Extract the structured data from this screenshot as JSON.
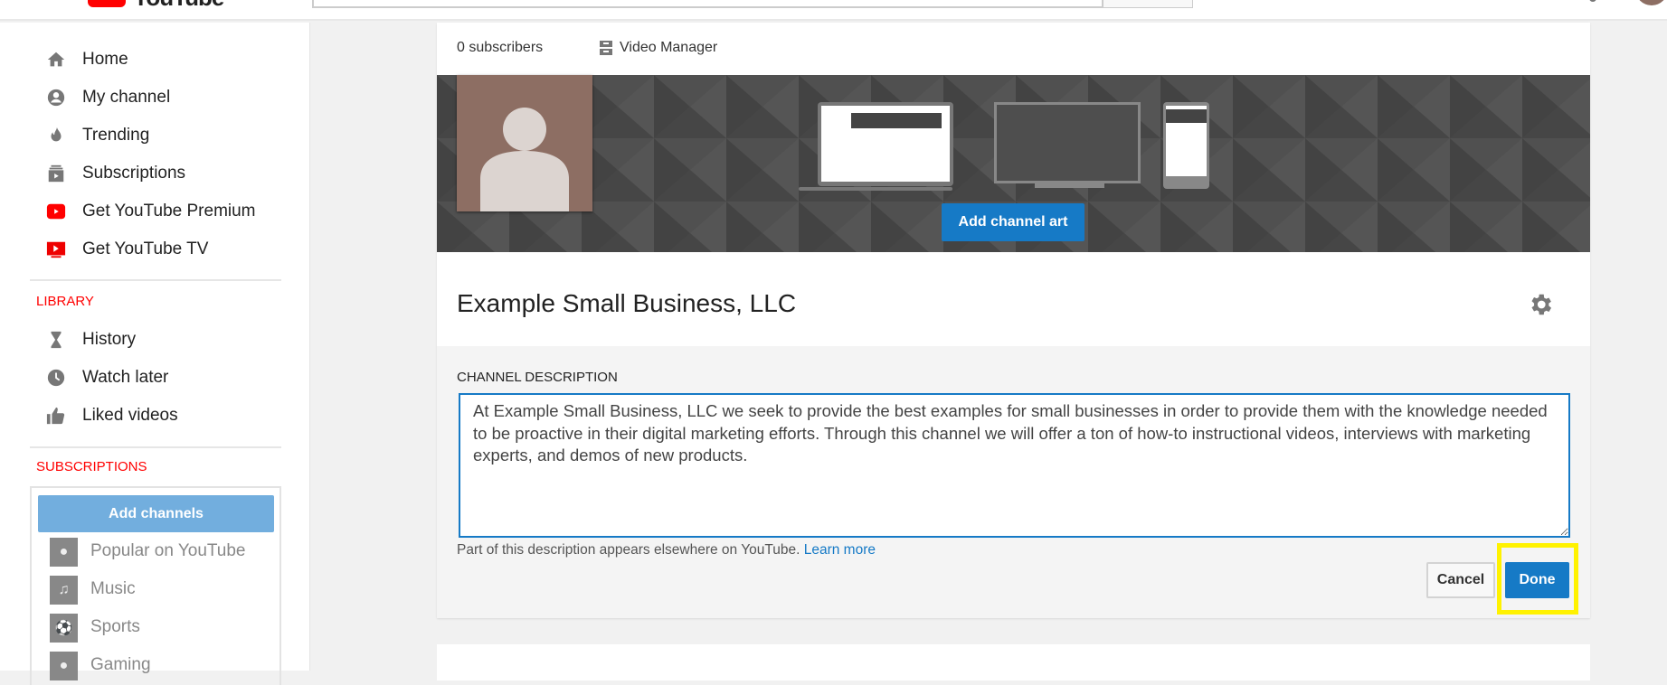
{
  "header": {
    "logo_text": "YouTube"
  },
  "sidebar": {
    "items": [
      {
        "label": "Home",
        "icon": "home-icon"
      },
      {
        "label": "My channel",
        "icon": "account-icon"
      },
      {
        "label": "Trending",
        "icon": "flame-icon"
      },
      {
        "label": "Subscriptions",
        "icon": "subscriptions-icon"
      },
      {
        "label": "Get YouTube Premium",
        "icon": "youtube-premium-icon"
      },
      {
        "label": "Get YouTube TV",
        "icon": "youtube-tv-icon"
      }
    ],
    "library_heading": "LIBRARY",
    "library": [
      {
        "label": "History",
        "icon": "hourglass-icon"
      },
      {
        "label": "Watch later",
        "icon": "clock-icon"
      },
      {
        "label": "Liked videos",
        "icon": "thumbs-up-icon"
      }
    ],
    "subscriptions_heading": "SUBSCRIPTIONS",
    "add_channels": "Add channels",
    "channels": [
      {
        "label": "Popular on YouTube"
      },
      {
        "label": "Music"
      },
      {
        "label": "Sports"
      },
      {
        "label": "Gaming"
      }
    ]
  },
  "channel": {
    "subscribers": "0 subscribers",
    "video_manager": "Video Manager",
    "add_channel_art": "Add channel art",
    "title": "Example Small Business, LLC",
    "description_label": "CHANNEL DESCRIPTION",
    "description": "At Example Small Business, LLC we seek to provide the best examples for small businesses in order to provide them with the knowledge needed to be proactive in their digital marketing efforts. Through this channel we will offer a ton of how-to instructional videos, interviews with marketing experts, and demos of new products.",
    "help_text": "Part of this description appears elsewhere on YouTube.",
    "learn_more": "Learn more",
    "cancel": "Cancel",
    "done": "Done"
  },
  "colors": {
    "accent": "#167ac6",
    "brand": "#ff0000",
    "highlight": "#fff200"
  }
}
